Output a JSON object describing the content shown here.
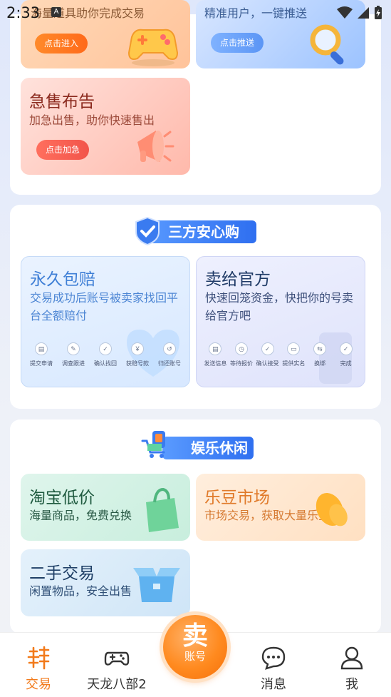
{
  "status_bar": {
    "time": "2:33"
  },
  "colors": {
    "accent": "#f27a1a",
    "blue_text": "#3f7fd6",
    "dark_text": "#1f3a66"
  },
  "top_section": {
    "game_tile": {
      "subtitle": "海量道具助你完成交易",
      "button": "点击进入"
    },
    "push_tile": {
      "subtitle": "精准用户，一键推送",
      "button": "点击推送"
    },
    "urgent_tile": {
      "title": "急售布告",
      "subtitle": "加急出售，助你快速售出",
      "button": "点击加急"
    }
  },
  "safe_section": {
    "header": "三方安心购",
    "guarantee": {
      "title": "永久包赔",
      "subtitle": "交易成功后账号被卖家找回平台全额赔付",
      "steps": [
        "提交申请",
        "调查跟进",
        "确认找回",
        "获赔号款",
        "归还账号"
      ]
    },
    "official": {
      "title": "卖给官方",
      "subtitle": "快速回笼资金，快把你的号卖给官方吧",
      "steps": [
        "发送信息",
        "等待报价",
        "确认接受",
        "提供实名",
        "换绑",
        "完成"
      ]
    }
  },
  "fun_section": {
    "header": "娱乐休闲",
    "taobao": {
      "title": "淘宝低价",
      "subtitle": "海量商品，免费兑换"
    },
    "ledou": {
      "title": "乐豆市场",
      "subtitle": "市场交易，获取大量乐豆"
    },
    "secondhand": {
      "title": "二手交易",
      "subtitle": "闲置物品，安全出售"
    }
  },
  "tab_bar": {
    "trade": "交易",
    "game": "天龙八部2",
    "sell_big": "卖",
    "sell_small": "账号",
    "messages": "消息",
    "me": "我"
  }
}
